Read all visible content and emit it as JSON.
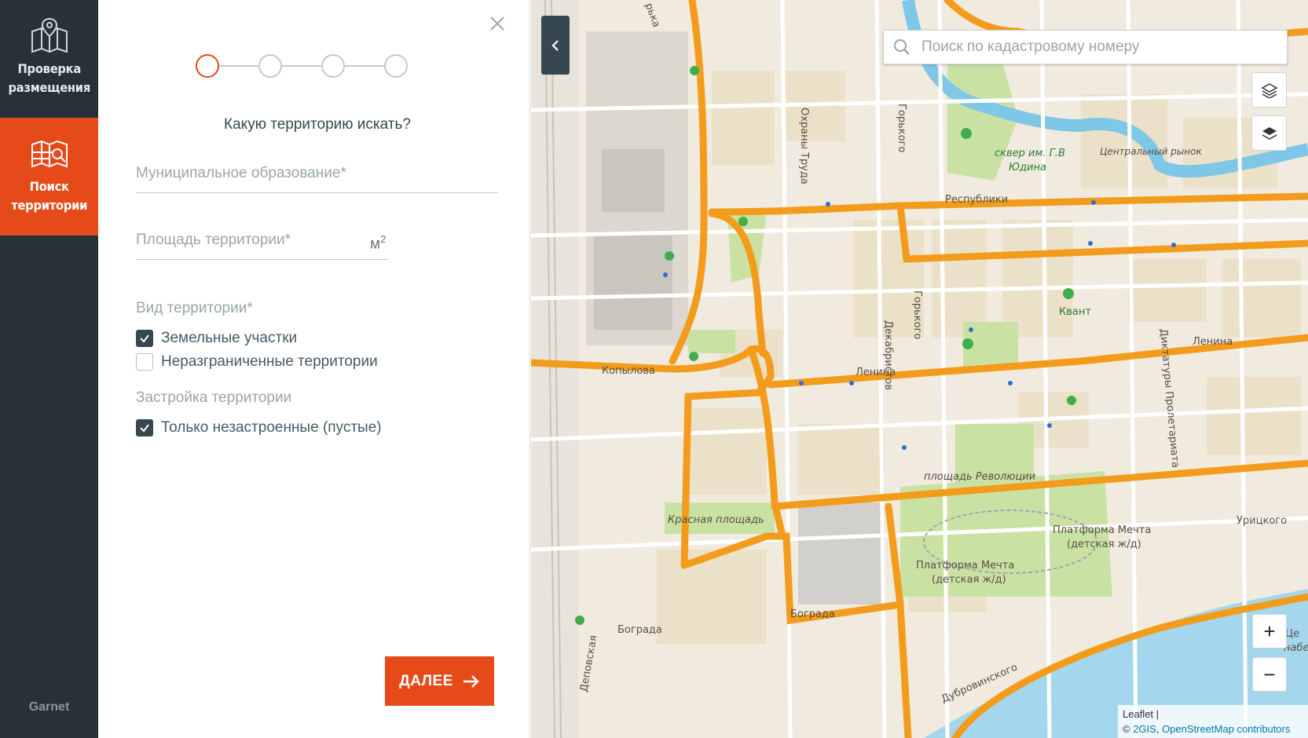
{
  "sidebar": {
    "items": [
      {
        "label": "Проверка\nразмещения",
        "icon": "map-pin-grid-icon",
        "active": false
      },
      {
        "label": "Поиск\nтерритории",
        "icon": "map-search-icon",
        "active": true
      }
    ],
    "brand": "Garnet"
  },
  "form": {
    "steps": {
      "total": 4,
      "current": 1
    },
    "question": "Какую территорию искать?",
    "municipality": {
      "placeholder": "Муниципальное образование*",
      "value": ""
    },
    "area": {
      "placeholder": "Площадь территории*",
      "value": "",
      "unit": "м",
      "unit_sup": "2"
    },
    "territory_type": {
      "title": "Вид территории*",
      "options": [
        {
          "label": "Земельные участки",
          "checked": true
        },
        {
          "label": "Неразграниченные территории",
          "checked": false
        }
      ]
    },
    "development": {
      "title": "Застройка территории",
      "options": [
        {
          "label": "Только незастроенные (пустые)",
          "checked": true
        }
      ]
    },
    "next_button": "ДАЛЕЕ"
  },
  "map": {
    "search_placeholder": "Поиск по кадастровому номеру",
    "zoom_in": "+",
    "zoom_out": "−",
    "attribution_leaflet": "Leaflet |",
    "attribution_prefix": "© ",
    "attribution_2gis": "2GIS",
    "attribution_sep": ", ",
    "attribution_osm": "OpenStreetMap contributors",
    "labels": {
      "respubliki": "Республики",
      "lenina1": "Ленина",
      "lenina2": "Ленина",
      "kopylova": "Копылова",
      "ploshad_rev": "площадь Революции",
      "krasnaya": "Красная площадь",
      "bograda1": "Бограда",
      "bograda2": "Бограда",
      "dubrovinskogo": "Дубровинского",
      "uritskogo": "Урицкого",
      "kvant": "Квант",
      "central_market": "Центральный рынок",
      "skver": "сквер им. Г.В",
      "yudina": "Юдина",
      "platforma1": "Платформа Мечта",
      "platforma1b": "(детская ж/д)",
      "platforma2": "Платформа Мечта",
      "platforma2b": "(детская ж/д)",
      "gorkogo1": "Горького",
      "gorkogo2": "Горького",
      "ohrany_truda": "Охраны Труда",
      "dekabristov": "Декабристов",
      "diktatury": "Диктатуры Пролетариата",
      "depovskaya": "Деповская",
      "ce": "Це",
      "nab": "набе",
      "urka": "рька"
    }
  }
}
